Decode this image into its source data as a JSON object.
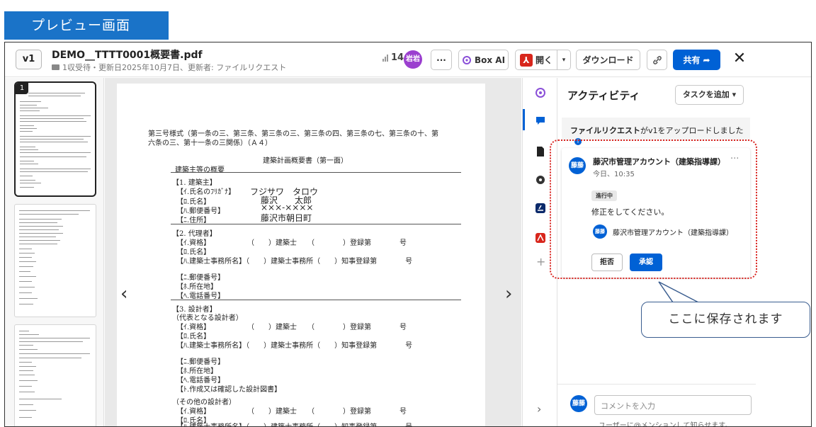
{
  "label": "プレビュー画面",
  "header": {
    "version": "v1",
    "file_name": "DEMO__TTTT0001概要書.pdf",
    "meta": "1収受待・更新日2025年10月7日、更新者: ファイルリクエスト",
    "views": "14",
    "avatar_initials": "岩岩",
    "more_label": "···",
    "box_ai_label": "Box AI",
    "open_label": "開く",
    "download_label": "ダウンロード",
    "share_label": "共有",
    "close_label": "✕"
  },
  "thumbnails": [
    {
      "page": "1"
    }
  ],
  "document": {
    "lines": [
      "第三号様式（第一条の三、第三条、第三条の三、第三条の四、第三条の七、第三条の十、第",
      "六条の三、第十一条の三関係）（Ａ４）",
      "建築計画概要書（第一面）",
      "建築主等の概要",
      "【1. 建築主】",
      "【ｲ.氏名のﾌﾘｶﾞﾅ】",
      "フジサワ　タロウ",
      "【ﾛ.氏名】",
      "藤沢　　太郎",
      "【ﾊ.郵便番号】",
      "×××-××××",
      "【ﾆ.住所】",
      "藤沢市朝日町",
      "【2. 代理者】",
      "【ｲ.資格】",
      "（　　）建築士　　（　　　　）登録第　　　　号",
      "【ﾛ.氏名】",
      "【ﾊ.建築士事務所名】（　　）建築士事務所（　　）知事登録第　　　　号",
      "【ﾆ.郵便番号】",
      "【ﾎ.所在地】",
      "【ﾍ.電話番号】",
      "【3. 設計者】",
      "（代表となる設計者）",
      "【ｲ.資格】",
      "（　　）建築士　　（　　　　）登録第　　　　号",
      "【ﾛ.氏名】",
      "【ﾊ.建築士事務所名】（　　）建築士事務所（　　）知事登録第　　　　号",
      "【ﾆ.郵便番号】",
      "【ﾎ.所在地】",
      "【ﾍ.電話番号】",
      "【ﾄ.作成又は確認した設計図書】",
      "（その他の設計者）",
      "【ｲ.資格】",
      "（　　）建築士　　（　　　　）登録第　　　　号",
      "【ﾛ.氏名】",
      "【ﾊ.建築士事務所名】（　　）建築士事務所（　　）知事登録第　　　　号"
    ]
  },
  "activity": {
    "title": "アクティビティ",
    "add_task_label": "タスクを追加 ▾",
    "notice_bold": "ファイルリクエスト",
    "notice_rest": "がv1をアップロードしました",
    "card": {
      "author": "藤沢市管理アカウント（建築指導課）",
      "avatar_initials": "藤藤",
      "time": "今日、10:35",
      "status": "進行中",
      "message": "修正をしてください。",
      "assignee": "藤沢市管理アカウント（建築指導課）",
      "reject_label": "拒否",
      "approve_label": "承認"
    },
    "comment_placeholder": "コメントを入力",
    "comment_hint": "ユーザーに@メンションして知らせます。"
  },
  "callout": "ここに保存されます",
  "colors": {
    "accent": "#0061d5",
    "label_bg": "#1a73c8",
    "highlight": "#d9231f",
    "pdf_red": "#d8261c",
    "avatar_purple": "#9b3fcf"
  }
}
